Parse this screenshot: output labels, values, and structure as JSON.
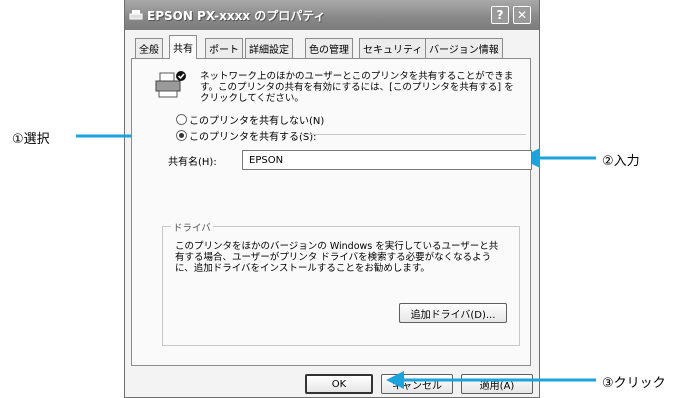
{
  "window": {
    "title": "EPSON PX-xxxx のプロパティ",
    "help_label": "?",
    "close_label": "✕"
  },
  "tabs": [
    {
      "label": "全般"
    },
    {
      "label": "共有"
    },
    {
      "label": "ポート"
    },
    {
      "label": "詳細設定"
    },
    {
      "label": "色の管理"
    },
    {
      "label": "セキュリティ"
    },
    {
      "label": "バージョン情報"
    }
  ],
  "sharing": {
    "intro": "ネットワーク上のほかのユーザーとこのプリンタを共有することができます。このプリンタの共有を有効にするには、[このプリンタを共有する] をクリックしてください。",
    "radio_not_shared": "このプリンタを共有しない(N)",
    "radio_shared": "このプリンタを共有する(S):",
    "selected": "shared",
    "share_name_label": "共有名(H):",
    "share_name_value": "EPSON"
  },
  "drivers": {
    "group_title": "ドライバ",
    "text": "このプリンタをほかのバージョンの Windows を実行しているユーザーと共有する場合、ユーザーがプリンタ ドライバを検索する必要がなくなるように、追加ドライバをインストールすることをお勧めします。",
    "button": "追加ドライバ(D)..."
  },
  "footer": {
    "ok": "OK",
    "cancel": "キャンセル",
    "apply": "適用(A)"
  },
  "annotations": {
    "select": "①選択",
    "input": "②入力",
    "click": "③クリック"
  },
  "icons": {
    "printer": "printer-share-icon",
    "arrow": "arrow-icon"
  },
  "colors": {
    "arrow": "#1aa3dc",
    "titlebar": "#8f8f8f"
  }
}
